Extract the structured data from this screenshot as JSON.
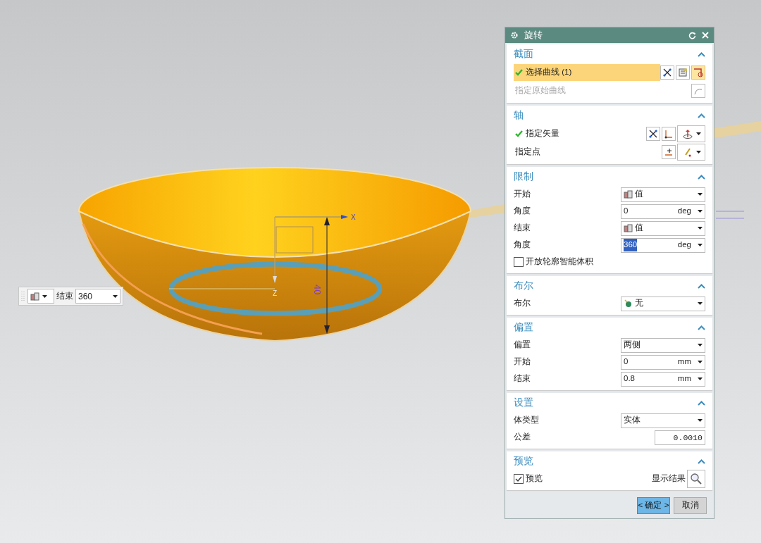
{
  "viewport": {
    "axis_labels": [
      {
        "text": "X"
      },
      {
        "text": "Z"
      }
    ],
    "dimension": "40",
    "toolbar": {
      "label": "结束",
      "value": "360"
    }
  },
  "dialog": {
    "title": "旋转",
    "sections": [
      {
        "title": "截面",
        "expanded": true,
        "rows": [
          {
            "kind": "pick",
            "label": "选择曲线 (1)",
            "checked": true,
            "selected": true,
            "disabled": false
          },
          {
            "kind": "pick",
            "label": "指定原始曲线",
            "checked": false,
            "selected": false,
            "disabled": true
          }
        ]
      },
      {
        "title": "轴",
        "expanded": true,
        "rows": [
          {
            "kind": "pick",
            "label": "指定矢量",
            "checked": true,
            "selected": false,
            "disabled": false
          },
          {
            "kind": "pick",
            "label": "指定点",
            "checked": false,
            "selected": false,
            "disabled": false
          }
        ]
      },
      {
        "title": "限制",
        "expanded": true,
        "rows": [
          {
            "kind": "icon_select",
            "label": "开始",
            "value": "值"
          },
          {
            "kind": "unit_value",
            "label": "角度",
            "value": "0",
            "unit": "deg",
            "selected": false
          },
          {
            "kind": "icon_select",
            "label": "结束",
            "value": "值"
          },
          {
            "kind": "unit_value",
            "label": "角度",
            "value": "360",
            "unit": "deg",
            "selected": true
          },
          {
            "kind": "checkbox",
            "label": "开放轮廓智能体积",
            "checked": false
          }
        ]
      },
      {
        "title": "布尔",
        "expanded": true,
        "rows": [
          {
            "kind": "icon_select",
            "label": "布尔",
            "value": "无"
          }
        ]
      },
      {
        "title": "偏置",
        "expanded": true,
        "rows": [
          {
            "kind": "select",
            "label": "偏置",
            "value": "两侧"
          },
          {
            "kind": "unit_value",
            "label": "开始",
            "value": "0",
            "unit": "mm",
            "selected": false
          },
          {
            "kind": "unit_value",
            "label": "结束",
            "value": "0.8",
            "unit": "mm",
            "selected": false
          }
        ]
      },
      {
        "title": "设置",
        "expanded": true,
        "rows": [
          {
            "kind": "select",
            "label": "体类型",
            "value": "实体"
          },
          {
            "kind": "number",
            "label": "公差",
            "value": "0.0010"
          }
        ]
      },
      {
        "title": "预览",
        "expanded": true,
        "rows": [
          {
            "kind": "checkbox_action",
            "label": "预览",
            "checked": true,
            "action": "显示结果"
          }
        ]
      }
    ],
    "buttons": [
      {
        "label": "< 确定 >",
        "kind": "primary"
      },
      {
        "label": "取消",
        "kind": "secondary"
      }
    ]
  }
}
